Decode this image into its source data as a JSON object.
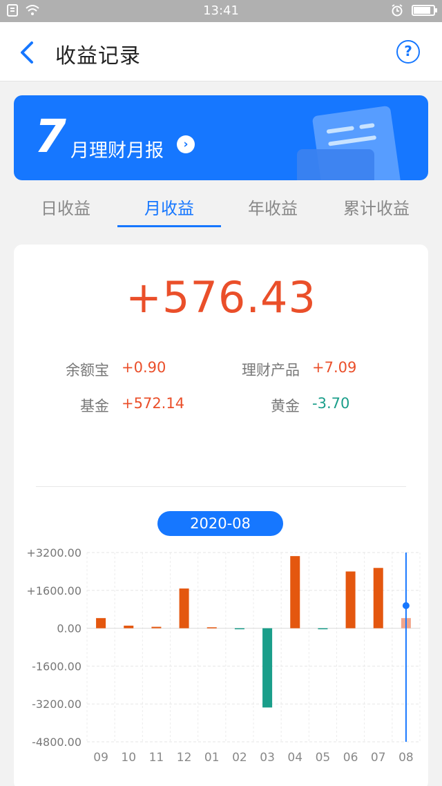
{
  "status_bar": {
    "time": "13:41"
  },
  "nav": {
    "title": "收益记录",
    "help_label": "?"
  },
  "banner": {
    "month": "7",
    "label": "月理财月报",
    "arrow": "›"
  },
  "tabs": [
    {
      "label": "日收益",
      "active": false
    },
    {
      "label": "月收益",
      "active": true
    },
    {
      "label": "年收益",
      "active": false
    },
    {
      "label": "累计收益",
      "active": false
    }
  ],
  "summary": {
    "total": "+576.43",
    "items": [
      {
        "label": "余额宝",
        "value": "+0.90",
        "sign": "pos"
      },
      {
        "label": "理财产品",
        "value": "+7.09",
        "sign": "pos"
      },
      {
        "label": "基金",
        "value": "+572.14",
        "sign": "pos"
      },
      {
        "label": "黄金",
        "value": "-3.70",
        "sign": "neg"
      }
    ]
  },
  "selected_period": "2020-08",
  "colors": {
    "accent": "#1677ff",
    "positive": "#e4570f",
    "negative": "#1a9e8a",
    "selected_bar": "#f2a58a"
  },
  "chart_data": {
    "type": "bar",
    "categories": [
      "09",
      "10",
      "11",
      "12",
      "01",
      "02",
      "03",
      "04",
      "05",
      "06",
      "07",
      "08"
    ],
    "values": [
      430,
      110,
      60,
      1680,
      40,
      -40,
      -3350,
      3050,
      -20,
      2400,
      2550,
      430
    ],
    "ylim": [
      -4800,
      3200
    ],
    "yticks": [
      3200,
      1600,
      0,
      -1600,
      -3200,
      -4800
    ],
    "ytick_labels": [
      "+3200.00",
      "+1600.00",
      "0.00",
      "-1600.00",
      "-3200.00",
      "-4800.00"
    ],
    "selected_index": 11,
    "grid": true
  }
}
